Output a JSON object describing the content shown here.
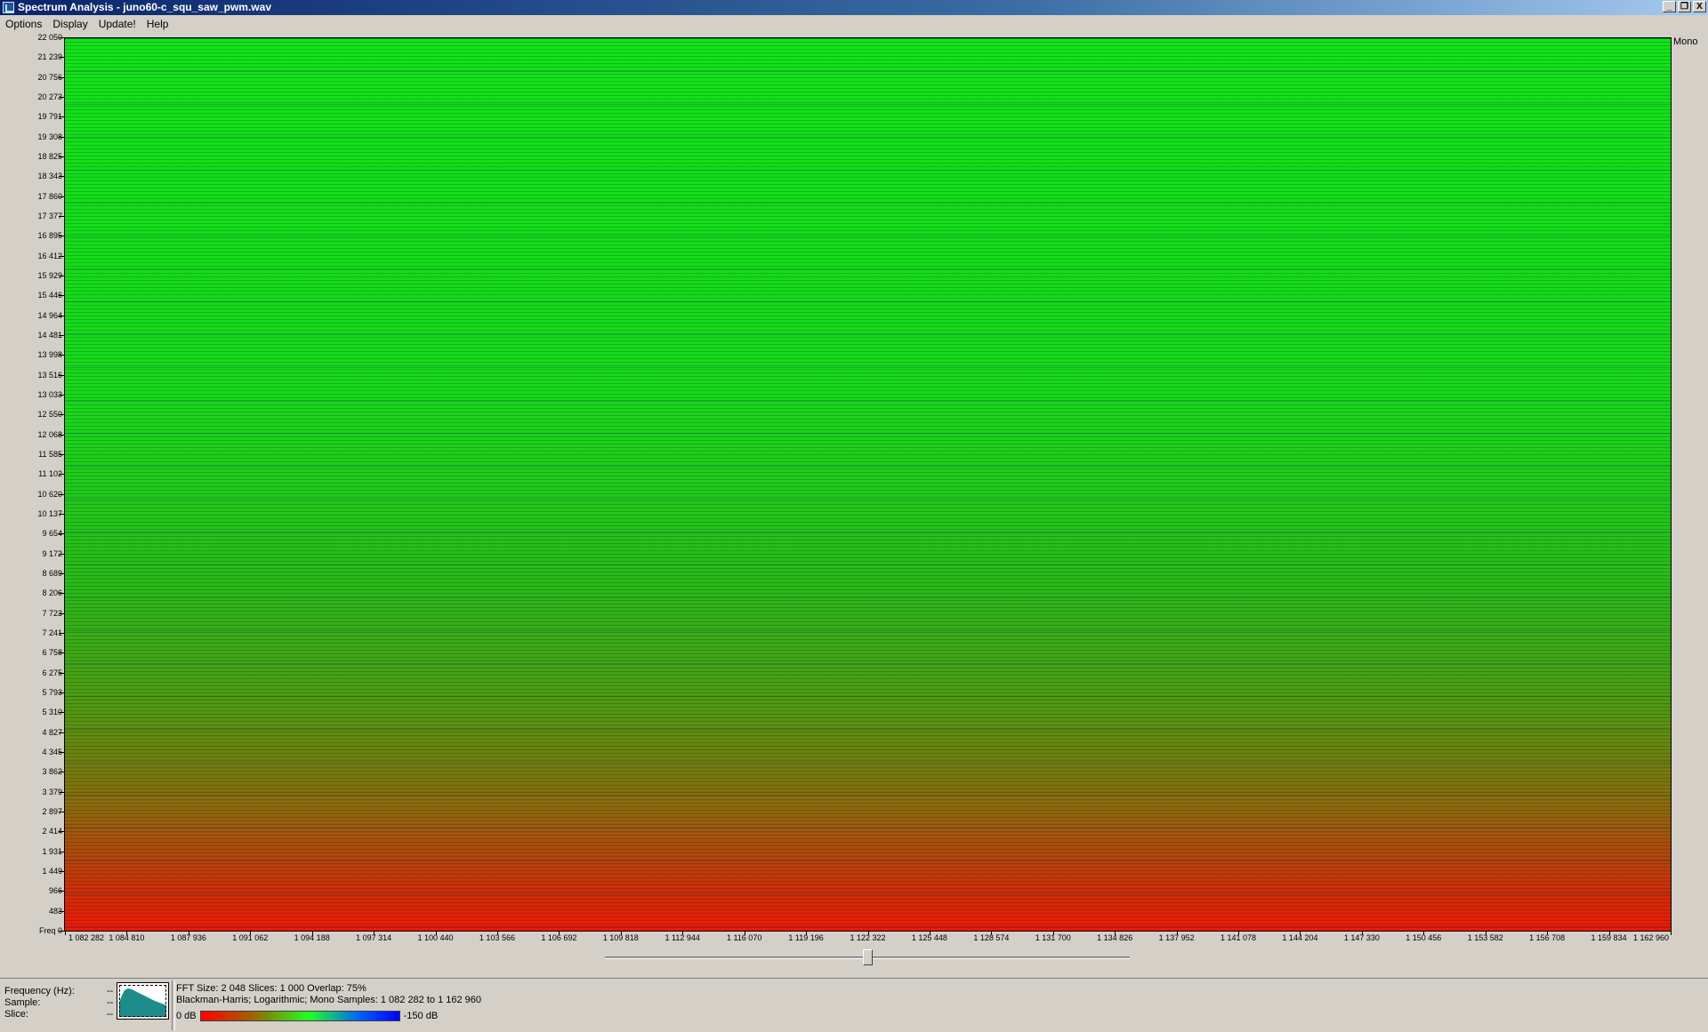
{
  "window": {
    "title": "Spectrum Analysis - juno60-c_squ_saw_pwm.wav",
    "buttons": [
      "_",
      "❐",
      "X"
    ]
  },
  "menu": [
    "Options",
    "Display",
    "Update!",
    "Help"
  ],
  "channel_label": "Mono",
  "y_axis": {
    "ticks": [
      "22 050",
      "21 239",
      "20 756",
      "20 273",
      "19 791",
      "19 308",
      "18 825",
      "18 343",
      "17 860",
      "17 377",
      "16 895",
      "16 412",
      "15 929",
      "15 446",
      "14 964",
      "14 481",
      "13 998",
      "13 516",
      "13 033",
      "12 550",
      "12 068",
      "11 585",
      "11 102",
      "10 620",
      "10 137",
      "9 654",
      "9 172",
      "8 689",
      "8 206",
      "7 723",
      "7 241",
      "6 758",
      "6 275",
      "5 793",
      "5 310",
      "4 827",
      "4 345",
      "3 862",
      "3 379",
      "2 897",
      "2 414",
      "1 931",
      "1 449",
      "966",
      "483",
      "Freq 0"
    ]
  },
  "x_axis": {
    "ticks": [
      "1 082 282",
      "1 084 810",
      "1 087 936",
      "1 091 062",
      "1 094 188",
      "1 097 314",
      "1 100 440",
      "1 103 566",
      "1 106 692",
      "1 109 818",
      "1 112 944",
      "1 116 070",
      "1 119 196",
      "1 122 322",
      "1 125 448",
      "1 128 574",
      "1 131 700",
      "1 134 826",
      "1 137 952",
      "1 141 078",
      "1 144 204",
      "1 147 330",
      "1 150 456",
      "1 153 582",
      "1 156 708",
      "1 159 834",
      "1 162 960"
    ]
  },
  "slider": {
    "position_fraction": 0.5
  },
  "info": {
    "frequency_label": "Frequency (Hz):",
    "sample_label": "Sample:",
    "slice_label": "Slice:",
    "frequency_value": "--",
    "sample_value": "--",
    "slice_value": "--"
  },
  "params": {
    "line1": "FFT Size: 2 048  Slices: 1 000  Overlap: 75%",
    "line2": "Blackman-Harris; Logarithmic; Mono  Samples: 1 082 282 to 1 162 960"
  },
  "legend": {
    "min_label": "0 dB",
    "max_label": "-150 dB"
  },
  "colors": {
    "high": "#12e21a",
    "low": "#ec1a08"
  }
}
